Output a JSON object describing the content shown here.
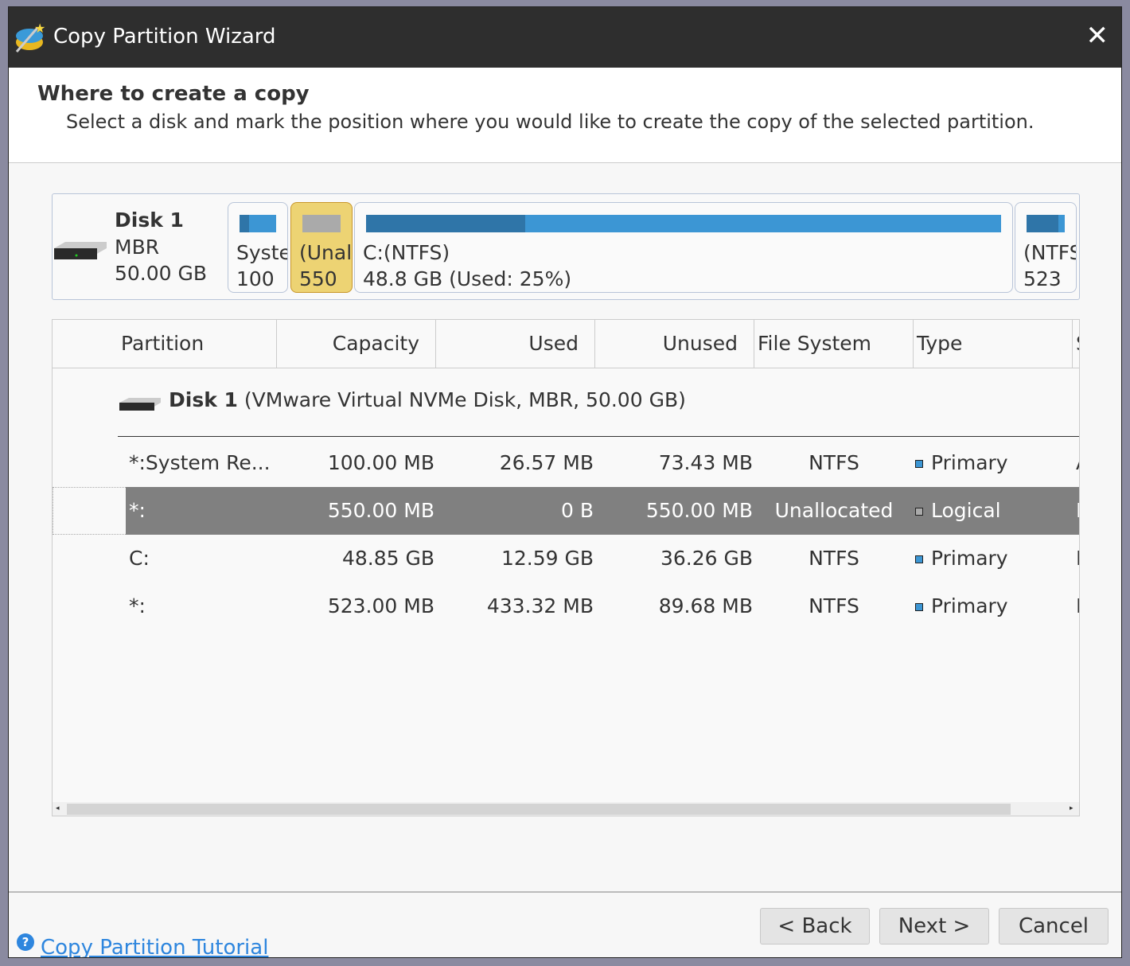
{
  "window": {
    "title": "Copy Partition Wizard",
    "close_icon": "close-icon"
  },
  "header": {
    "title": "Where to create a copy",
    "subtitle": "Select a disk and mark the position where you would like to create the copy of the selected partition."
  },
  "disk_map": {
    "disk": {
      "name": "Disk 1",
      "scheme": "MBR",
      "size": "50.00 GB"
    },
    "partitions": [
      {
        "label": "System Reserved",
        "size": "100",
        "used_pct": 27,
        "selected": false
      },
      {
        "label": "(Unallocated)",
        "size": "550",
        "used_pct": 0,
        "selected": true
      },
      {
        "label": "C:(NTFS)",
        "size": "48.8 GB (Used: 25%)",
        "used_pct": 25,
        "selected": false
      },
      {
        "label": "(NTFS)",
        "size": "523",
        "used_pct": 83,
        "selected": false
      }
    ]
  },
  "table": {
    "columns": [
      "Partition",
      "Capacity",
      "Used",
      "Unused",
      "File System",
      "Type",
      "Status"
    ],
    "disk_row": {
      "name": "Disk 1",
      "detail": "(VMware Virtual NVMe Disk, MBR, 50.00 GB)"
    },
    "rows": [
      {
        "partition": "*:System Re...",
        "capacity": "100.00 MB",
        "used": "26.57 MB",
        "unused": "73.43 MB",
        "fs": "NTFS",
        "type": "Primary",
        "status": "Active",
        "selected": false
      },
      {
        "partition": "*:",
        "capacity": "550.00 MB",
        "used": "0 B",
        "unused": "550.00 MB",
        "fs": "Unallocated",
        "type": "Logical",
        "status": "None",
        "selected": true
      },
      {
        "partition": "C:",
        "capacity": "48.85 GB",
        "used": "12.59 GB",
        "unused": "36.26 GB",
        "fs": "NTFS",
        "type": "Primary",
        "status": "Boot",
        "selected": false
      },
      {
        "partition": "*:",
        "capacity": "523.00 MB",
        "used": "433.32 MB",
        "unused": "89.68 MB",
        "fs": "NTFS",
        "type": "Primary",
        "status": "None",
        "selected": false
      }
    ]
  },
  "footer": {
    "tutorial_link": "Copy Partition Tutorial",
    "back": "< Back",
    "next": "Next >",
    "cancel": "Cancel"
  },
  "colors": {
    "titlebar": "#2e2e2e",
    "partition_bar": "#3c96d4",
    "selected_block": "#edd373",
    "selected_row": "#808080",
    "link": "#2e86de"
  }
}
